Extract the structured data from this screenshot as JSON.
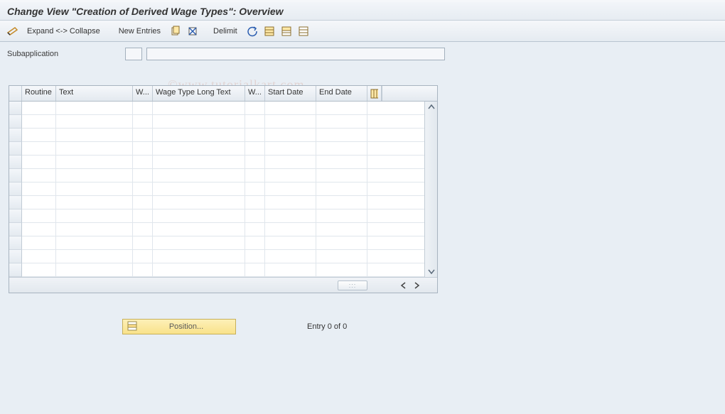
{
  "title": "Change View \"Creation of Derived Wage Types\": Overview",
  "toolbar": {
    "expand_collapse": "Expand <-> Collapse",
    "new_entries": "New Entries",
    "delimit": "Delimit",
    "icons": {
      "glasses": "toggle-icon",
      "copy": "copy-icon",
      "delete": "delete-icon",
      "undo": "undo-icon",
      "select_all": "select-all-icon",
      "select_block": "select-block-icon",
      "deselect": "deselect-icon"
    }
  },
  "subapp": {
    "label": "Subapplication",
    "value_small": "",
    "value_large": ""
  },
  "grid": {
    "columns": {
      "routine": "Routine",
      "text": "Text",
      "w1": "W...",
      "wage_long": "Wage Type Long Text",
      "w2": "W...",
      "start": "Start Date",
      "end": "End Date"
    },
    "rows": [
      "",
      "",
      "",
      "",
      "",
      "",
      "",
      "",
      "",
      "",
      "",
      "",
      ""
    ]
  },
  "footer": {
    "position_label": "Position...",
    "entry_text": "Entry 0 of 0"
  },
  "watermark": "©www.tutorialkart.com"
}
